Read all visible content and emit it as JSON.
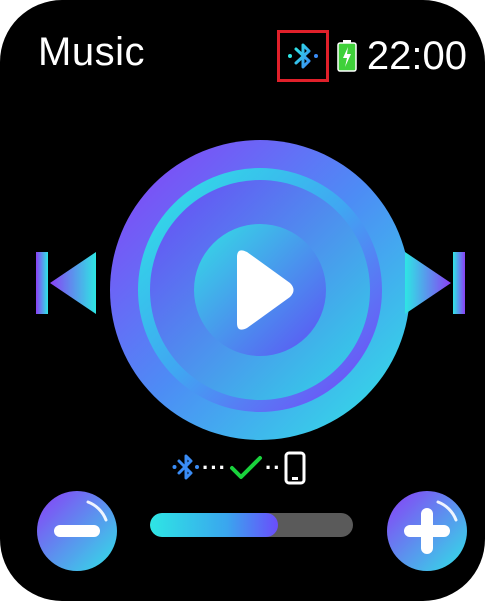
{
  "app": {
    "title": "Music",
    "time": "22:00"
  },
  "status": {
    "bluetooth_icon": "bluetooth-icon",
    "bluetooth_highlighted": true,
    "battery_icon": "battery-charging-icon",
    "battery_color": "#3fd13a"
  },
  "controls": {
    "previous_icon": "skip-previous-icon",
    "play_icon": "play-icon",
    "next_icon": "skip-next-icon"
  },
  "connection": {
    "icons": [
      "bluetooth-icon",
      "checkmark-icon",
      "phone-icon"
    ],
    "dots_left": "···",
    "dots_right": "··",
    "check_color": "#19d23c"
  },
  "volume": {
    "minus_icon": "minus-icon",
    "plus_icon": "plus-icon",
    "level": 0.63
  },
  "colors": {
    "background": "#000000",
    "accent_cyan": "#2ee6e4",
    "accent_purple": "#7a3df8",
    "track": "#5a5a5a"
  }
}
